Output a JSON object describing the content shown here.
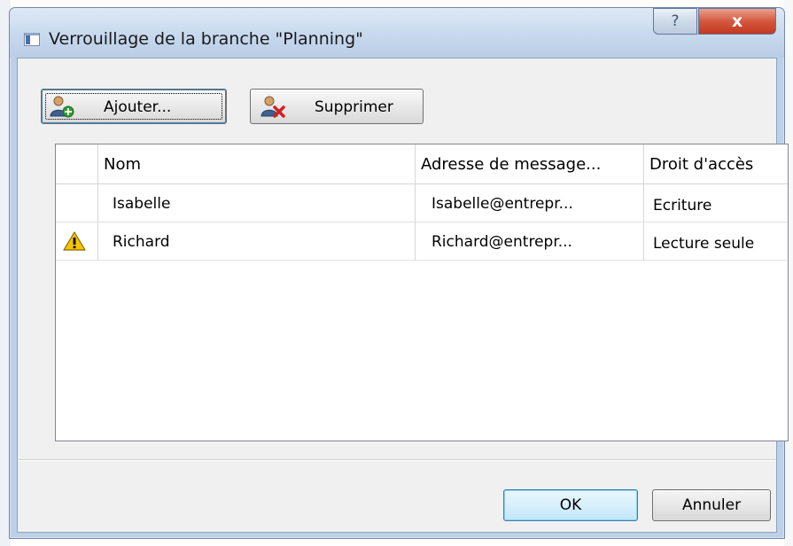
{
  "window": {
    "title": "Verrouillage de la branche \"Planning\"",
    "help_glyph": "?",
    "close_glyph": "x"
  },
  "toolbar": {
    "add_label": "Ajouter...",
    "add_icon": "user-add-icon",
    "delete_label": "Supprimer",
    "delete_icon": "user-remove-icon"
  },
  "table": {
    "columns": [
      "",
      "Nom",
      "Adresse de message...",
      "Droit d'accès"
    ],
    "rows": [
      {
        "status_icon": "",
        "name": "Isabelle",
        "email": "Isabelle@entrepr...",
        "access": "Ecriture"
      },
      {
        "status_icon": "warning-icon",
        "name": "Richard",
        "email": "Richard@entrepr...",
        "access": "Lecture seule"
      }
    ]
  },
  "footer": {
    "ok_label": "OK",
    "cancel_label": "Annuler"
  },
  "colors": {
    "title_bar": "#c9daee",
    "close_button": "#c2391f",
    "warning": "#f5c400",
    "add_accent": "#2e9b2e",
    "delete_accent": "#d21f1f"
  }
}
